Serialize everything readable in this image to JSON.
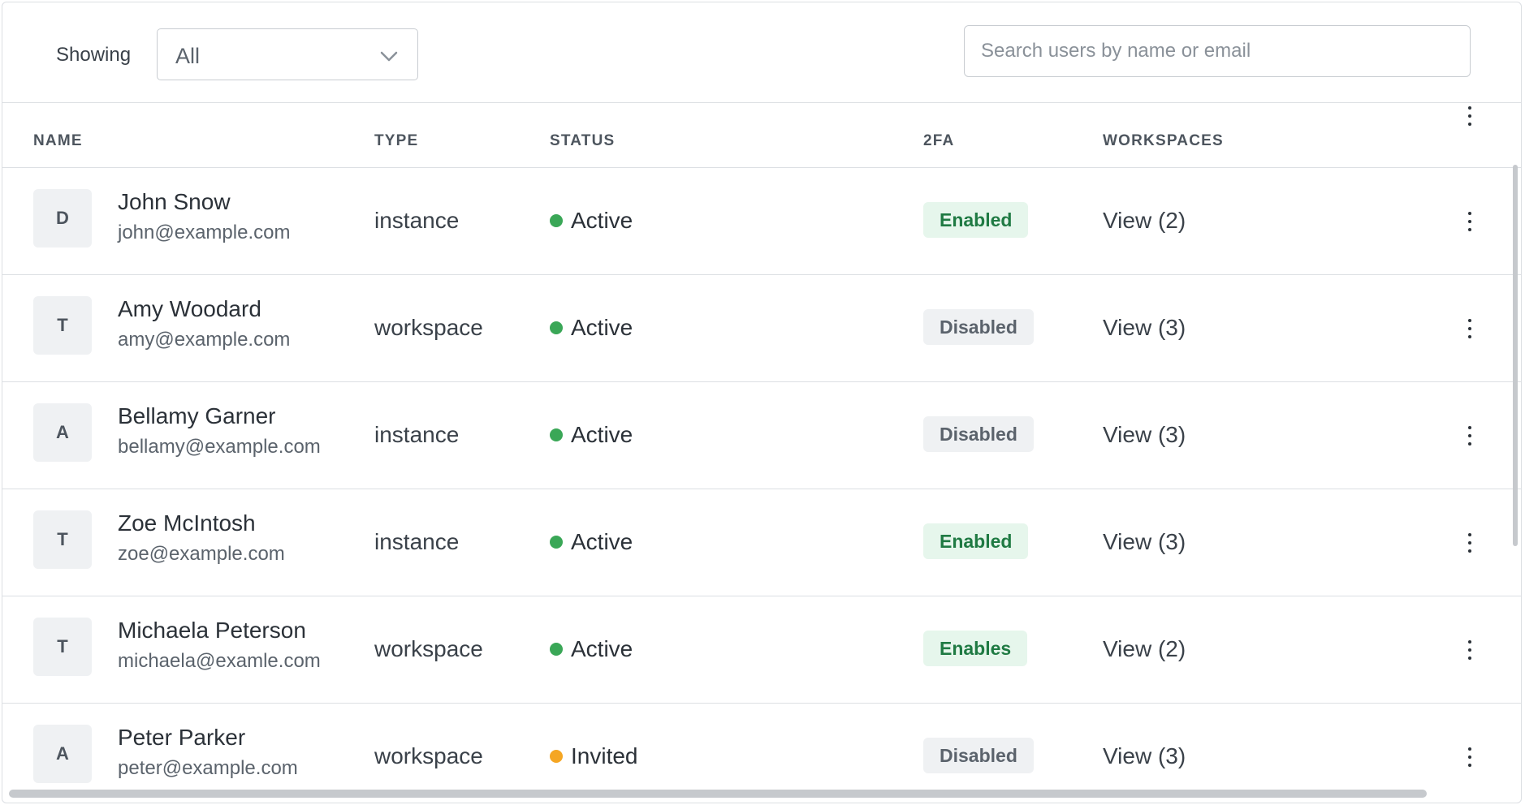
{
  "toolbar": {
    "showing_label": "Showing",
    "filter_value": "All",
    "search_placeholder": "Search users by name or email"
  },
  "columns": {
    "name": "NAME",
    "type": "TYPE",
    "status": "STATUS",
    "twofa": "2FA",
    "workspaces": "WORKSPACES"
  },
  "colors": {
    "active": "#3aa757",
    "invited": "#f5a623",
    "enabled_bg": "#e6f6ec",
    "enabled_text": "#1f7a43",
    "disabled_bg": "#eff1f3",
    "disabled_text": "#5b636c"
  },
  "users": [
    {
      "initial": "D",
      "name": "John Snow",
      "email": "john@example.com",
      "type": "instance",
      "status": "Active",
      "status_color": "#3aa757",
      "twofa": "Enabled",
      "twofa_state": "enabled",
      "workspaces": "View (2)"
    },
    {
      "initial": "T",
      "name": "Amy Woodard",
      "email": "amy@example.com",
      "type": "workspace",
      "status": "Active",
      "status_color": "#3aa757",
      "twofa": "Disabled",
      "twofa_state": "disabled",
      "workspaces": "View (3)"
    },
    {
      "initial": "A",
      "name": "Bellamy Garner",
      "email": "bellamy@example.com",
      "type": "instance",
      "status": "Active",
      "status_color": "#3aa757",
      "twofa": "Disabled",
      "twofa_state": "disabled",
      "workspaces": "View (3)"
    },
    {
      "initial": "T",
      "name": "Zoe McIntosh",
      "email": "zoe@example.com",
      "type": "instance",
      "status": "Active",
      "status_color": "#3aa757",
      "twofa": "Enabled",
      "twofa_state": "enabled",
      "workspaces": "View (3)"
    },
    {
      "initial": "T",
      "name": "Michaela Peterson",
      "email": "michaela@examle.com",
      "type": "workspace",
      "status": "Active",
      "status_color": "#3aa757",
      "twofa": "Enables",
      "twofa_state": "enabled",
      "workspaces": "View (2)"
    },
    {
      "initial": "A",
      "name": "Peter Parker",
      "email": "peter@example.com",
      "type": "workspace",
      "status": "Invited",
      "status_color": "#f5a623",
      "twofa": "Disabled",
      "twofa_state": "disabled",
      "workspaces": "View (3)"
    }
  ]
}
